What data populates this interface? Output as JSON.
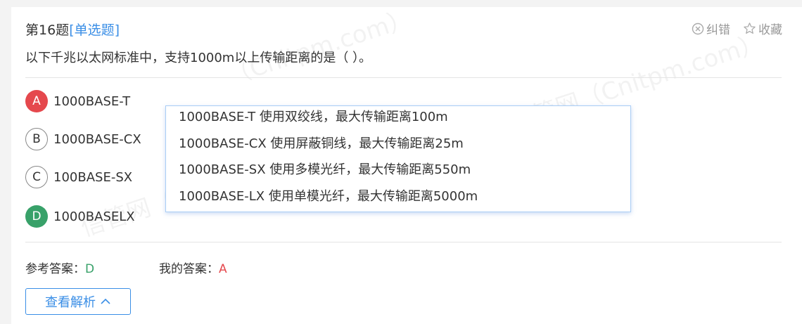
{
  "question": {
    "number_label": "第16题",
    "type_label": "[单选题]",
    "stem": "以下千兆以太网标准中，支持1000m以上传输距离的是（ ）。"
  },
  "actions": {
    "report_label": "纠错",
    "collect_label": "收藏"
  },
  "options": [
    {
      "letter": "A",
      "text": "1000BASE-T",
      "state": "wrong"
    },
    {
      "letter": "B",
      "text": "1000BASE-CX",
      "state": "plain"
    },
    {
      "letter": "C",
      "text": "100BASE-SX",
      "state": "plain"
    },
    {
      "letter": "D",
      "text": "1000BASELX",
      "state": "right"
    }
  ],
  "popover": {
    "lines": [
      "1000BASE-T 使用双绞线，最大传输距离100m",
      "1000BASE-CX 使用屏蔽铜线，最大传输距离25m",
      "1000BASE-SX 使用多模光纤，最大传输距离550m",
      "1000BASE-LX 使用单模光纤，最大传输距离5000m"
    ]
  },
  "answers": {
    "ref_label": "参考答案：",
    "ref_value": "D",
    "mine_label": "我的答案：",
    "mine_value": "A"
  },
  "view_button_label": "查看解析",
  "watermark": {
    "text_1": "（Cnitpm.com）",
    "text_2": "信管网（Cnitpm.com）"
  },
  "colors": {
    "accent": "#3a8ee6",
    "correct": "#38a169",
    "wrong": "#e5484d"
  }
}
